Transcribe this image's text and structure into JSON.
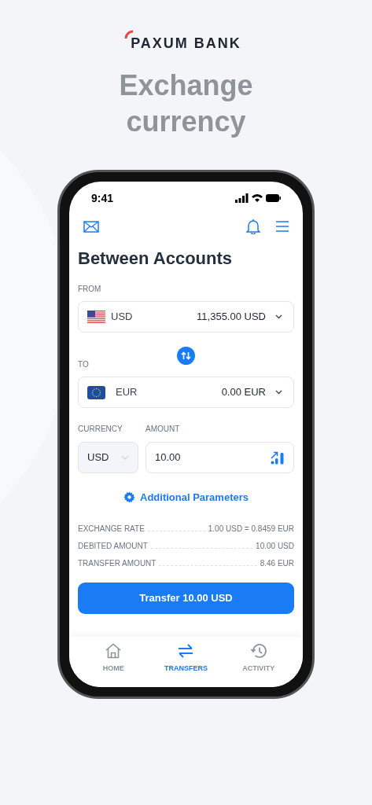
{
  "brand": "PAXUM BANK",
  "headline": "Exchange currency",
  "status_bar": {
    "time": "9:41"
  },
  "screen_title": "Between Accounts",
  "from": {
    "label": "FROM",
    "currency": "USD",
    "balance": "11,355.00 USD"
  },
  "to": {
    "label": "TO",
    "currency": "EUR",
    "balance": "0.00 EUR"
  },
  "currency_field": {
    "label": "CURRENCY",
    "value": "USD",
    "disabled": true
  },
  "amount_field": {
    "label": "AMOUNT",
    "value": "10.00"
  },
  "additional_link": "Additional Parameters",
  "details": [
    {
      "label": "EXCHANGE RATE",
      "value": "1.00 USD = 0.8459 EUR"
    },
    {
      "label": "DEBITED AMOUNT",
      "value": "10.00 USD"
    },
    {
      "label": "TRANSFER AMOUNT",
      "value": "8.46 EUR"
    }
  ],
  "transfer_button": "Transfer 10.00 USD",
  "tabs": [
    {
      "label": "HOME",
      "selected": false
    },
    {
      "label": "TRANSFERS",
      "selected": true
    },
    {
      "label": "ACTIVITY",
      "selected": false
    }
  ]
}
